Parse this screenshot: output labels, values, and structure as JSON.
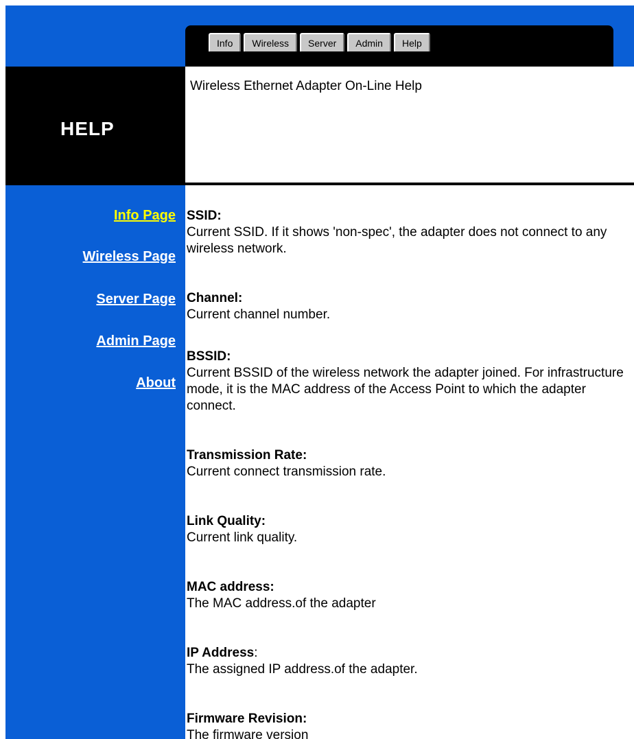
{
  "tabs": [
    {
      "label": "Info"
    },
    {
      "label": "Wireless"
    },
    {
      "label": "Server"
    },
    {
      "label": "Admin"
    },
    {
      "label": "Help"
    }
  ],
  "header": {
    "section_title": "HELP",
    "subtitle": "Wireless Ethernet Adapter On-Line Help"
  },
  "sidebar": {
    "items": [
      {
        "label": "Info Page"
      },
      {
        "label": "Wireless Page"
      },
      {
        "label": "Server Page"
      },
      {
        "label": "Admin Page"
      },
      {
        "label": "About"
      }
    ]
  },
  "entries": [
    {
      "title": "SSID:",
      "description": "Current SSID. If it shows 'non-spec', the adapter does not connect to any wireless network."
    },
    {
      "title": "Channel:",
      "description": "Current channel number."
    },
    {
      "title": "BSSID:",
      "description": "Current BSSID of the wireless network the adapter joined. For infrastructure mode, it is the MAC address of the Access Point to which the adapter connect."
    },
    {
      "title": "Transmission Rate:",
      "description": "Current connect transmission rate."
    },
    {
      "title": "Link Quality:",
      "description": "Current link quality."
    },
    {
      "title": "MAC address:",
      "description": "The MAC address.of the adapter"
    },
    {
      "title": "IP Address",
      "title_suffix": ":",
      "description": "The assigned IP address.of the adapter."
    },
    {
      "title": "Firmware Revision:",
      "description": "The firmware version"
    }
  ],
  "colors": {
    "brand_blue": "#0a5fd6",
    "active_link": "#ffff00",
    "header_black": "#000000"
  }
}
